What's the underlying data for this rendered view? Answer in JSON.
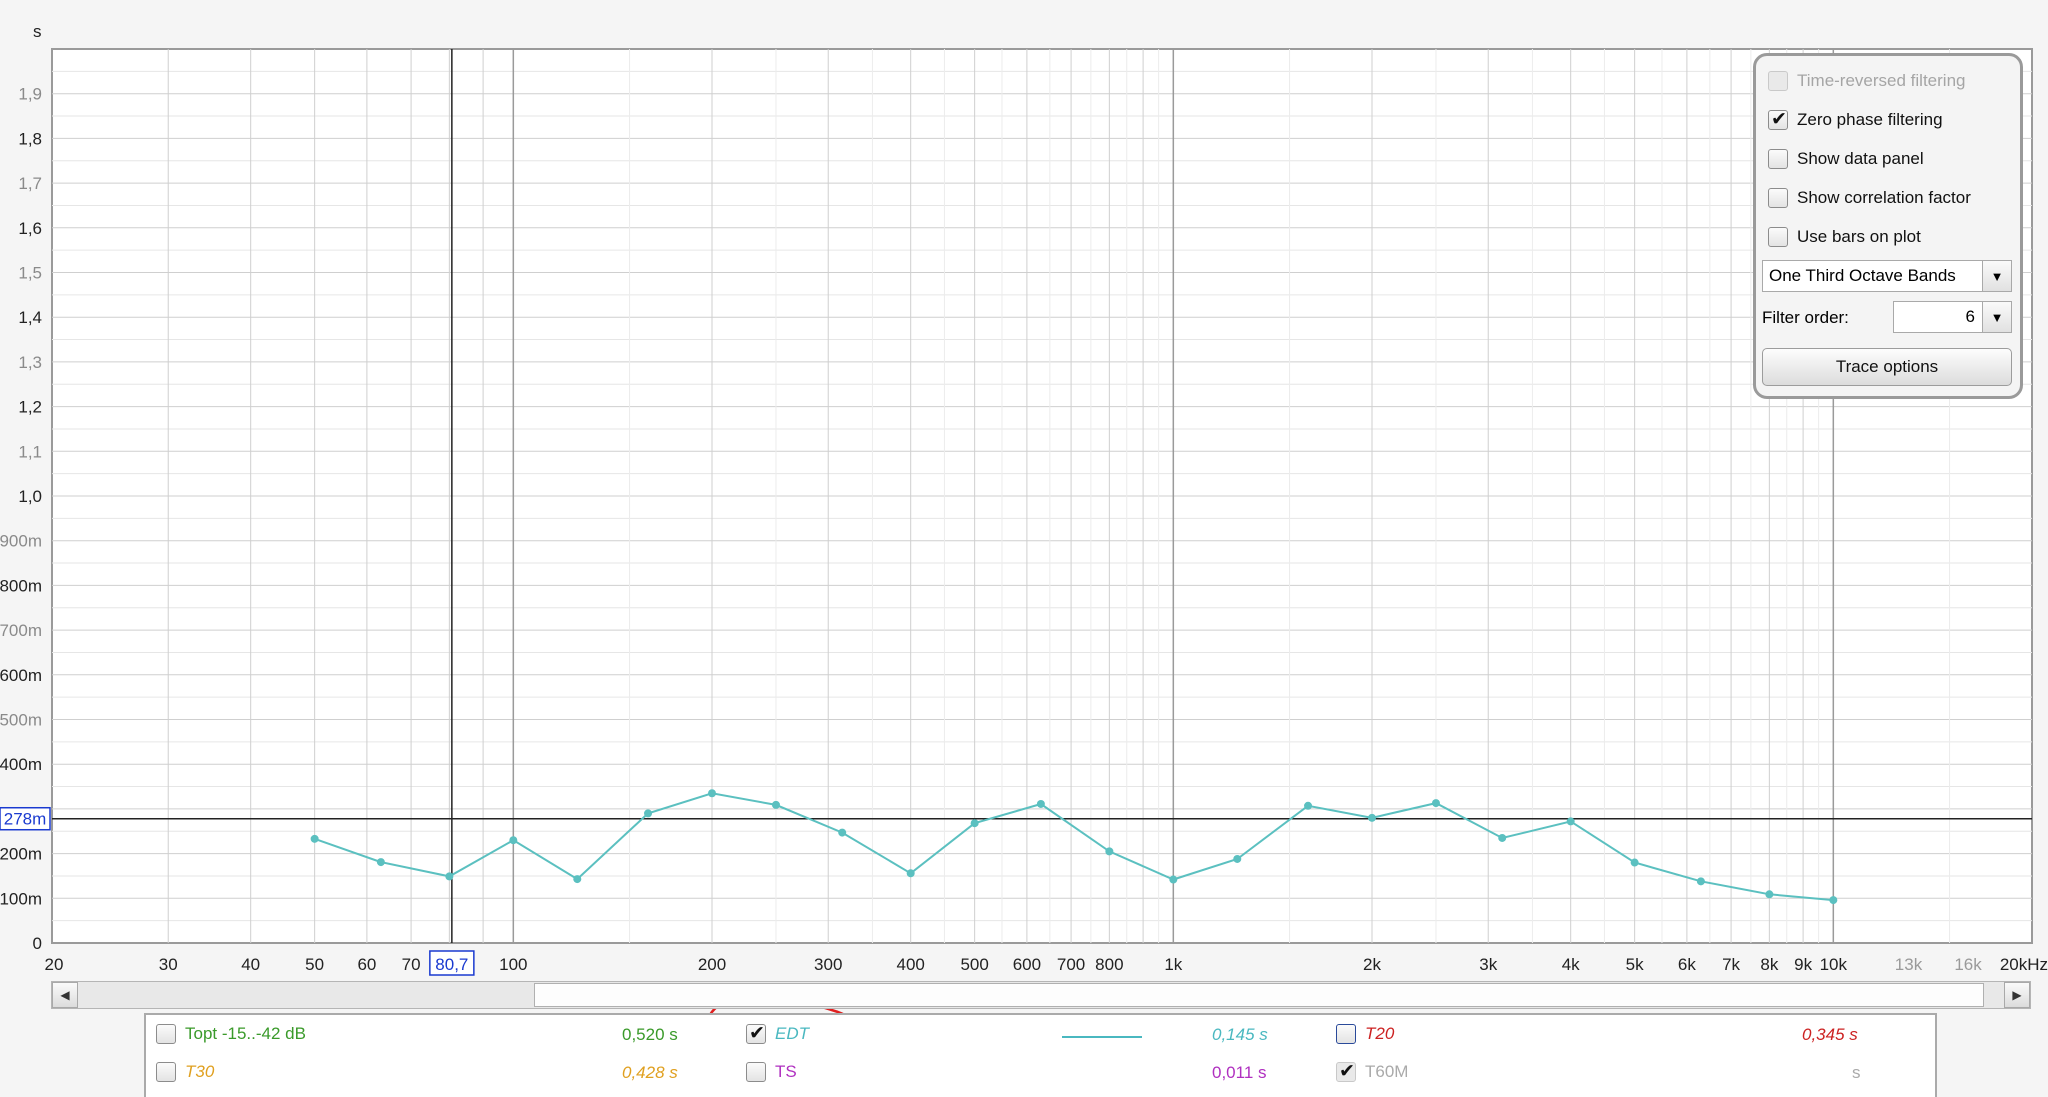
{
  "chart_data": {
    "type": "line",
    "y_unit": "s",
    "x_unit": "Hz",
    "x_scale": "log",
    "xlim": [
      20,
      20000
    ],
    "ylim": [
      0,
      2.0
    ],
    "grid": true,
    "x_ticks": [
      {
        "v": 20,
        "label": "20",
        "major": true
      },
      {
        "v": 30,
        "label": "30",
        "major": true
      },
      {
        "v": 40,
        "label": "40",
        "major": true
      },
      {
        "v": 50,
        "label": "50",
        "major": true
      },
      {
        "v": 60,
        "label": "60",
        "major": true
      },
      {
        "v": 70,
        "label": "70",
        "major": true
      },
      {
        "v": 100,
        "label": "100",
        "major": true
      },
      {
        "v": 200,
        "label": "200",
        "major": true
      },
      {
        "v": 300,
        "label": "300",
        "major": true
      },
      {
        "v": 400,
        "label": "400",
        "major": true
      },
      {
        "v": 500,
        "label": "500",
        "major": true
      },
      {
        "v": 600,
        "label": "600",
        "major": true
      },
      {
        "v": 700,
        "label": "700",
        "major": true
      },
      {
        "v": 800,
        "label": "800",
        "major": true
      },
      {
        "v": 1000,
        "label": "1k",
        "major": true
      },
      {
        "v": 2000,
        "label": "2k",
        "major": true
      },
      {
        "v": 3000,
        "label": "3k",
        "major": true
      },
      {
        "v": 4000,
        "label": "4k",
        "major": true
      },
      {
        "v": 5000,
        "label": "5k",
        "major": true
      },
      {
        "v": 6000,
        "label": "6k",
        "major": true
      },
      {
        "v": 7000,
        "label": "7k",
        "major": true
      },
      {
        "v": 8000,
        "label": "8k",
        "major": true
      },
      {
        "v": 9000,
        "label": "9k",
        "major": true
      },
      {
        "v": 10000,
        "label": "10k",
        "major": true
      },
      {
        "v": 13000,
        "label": "13k",
        "major": false
      },
      {
        "v": 16000,
        "label": "16k",
        "major": false
      },
      {
        "v": 20000,
        "label": "20kHz",
        "major": true
      }
    ],
    "y_ticks": [
      {
        "v": 0,
        "label": "0",
        "major": true
      },
      {
        "v": 0.1,
        "label": "100m",
        "major": true
      },
      {
        "v": 0.2,
        "label": "200m",
        "major": true
      },
      {
        "v": 0.4,
        "label": "400m",
        "major": true
      },
      {
        "v": 0.5,
        "label": "500m",
        "major": false
      },
      {
        "v": 0.6,
        "label": "600m",
        "major": true
      },
      {
        "v": 0.7,
        "label": "700m",
        "major": false
      },
      {
        "v": 0.8,
        "label": "800m",
        "major": true
      },
      {
        "v": 0.9,
        "label": "900m",
        "major": false
      },
      {
        "v": 1.0,
        "label": "1,0",
        "major": true
      },
      {
        "v": 1.1,
        "label": "1,1",
        "major": false
      },
      {
        "v": 1.2,
        "label": "1,2",
        "major": true
      },
      {
        "v": 1.3,
        "label": "1,3",
        "major": false
      },
      {
        "v": 1.4,
        "label": "1,4",
        "major": true
      },
      {
        "v": 1.5,
        "label": "1,5",
        "major": false
      },
      {
        "v": 1.6,
        "label": "1,6",
        "major": true
      },
      {
        "v": 1.7,
        "label": "1,7",
        "major": false
      },
      {
        "v": 1.8,
        "label": "1,8",
        "major": true
      },
      {
        "v": 1.9,
        "label": "1,9",
        "major": false
      }
    ],
    "series": [
      {
        "name": "EDT",
        "color": "#5bc0c0",
        "x": [
          50,
          63,
          80,
          100,
          125,
          160,
          200,
          250,
          315,
          400,
          500,
          630,
          800,
          1000,
          1250,
          1600,
          2000,
          2500,
          3150,
          4000,
          5000,
          6300,
          8000,
          10000
        ],
        "y": [
          0.233,
          0.181,
          0.149,
          0.23,
          0.143,
          0.29,
          0.335,
          0.309,
          0.247,
          0.156,
          0.268,
          0.311,
          0.205,
          0.142,
          0.188,
          0.307,
          0.28,
          0.313,
          0.235,
          0.272,
          0.18,
          0.138,
          0.109,
          0.096
        ]
      }
    ],
    "cursor": {
      "x": 80.7,
      "y": 0.278,
      "x_label": "80,7",
      "y_label": "278m"
    }
  },
  "options": {
    "time_reversed_filtering": {
      "label": "Time-reversed filtering",
      "checked": false,
      "enabled": false
    },
    "zero_phase_filtering": {
      "label": "Zero phase filtering",
      "checked": true
    },
    "show_data_panel": {
      "label": "Show data panel",
      "checked": false
    },
    "show_correlation_factor": {
      "label": "Show correlation factor",
      "checked": false
    },
    "use_bars_on_plot": {
      "label": "Use bars on plot",
      "checked": false
    },
    "band_select": {
      "value": "One Third Octave Bands"
    },
    "filter_order": {
      "label": "Filter order:",
      "value": "6"
    },
    "trace_options": {
      "label": "Trace options"
    }
  },
  "legend": {
    "topt": {
      "label": "Topt -15..-42 dB",
      "value": "0,520 s",
      "color": "#3a9a2a"
    },
    "t30": {
      "label": "T30",
      "value": "0,428 s",
      "color": "#e0a020"
    },
    "edt": {
      "label": "EDT",
      "value": "0,145 s",
      "color": "#4ab8c0"
    },
    "ts": {
      "label": "TS",
      "value": "0,011 s",
      "color": "#b030c0"
    },
    "t20": {
      "label": "T20",
      "value": "0,345 s",
      "color": "#cc2222"
    },
    "t60m": {
      "label": "T60M",
      "value": "s",
      "color": "#aaaaaa"
    }
  },
  "annotation_color": "#e02020"
}
